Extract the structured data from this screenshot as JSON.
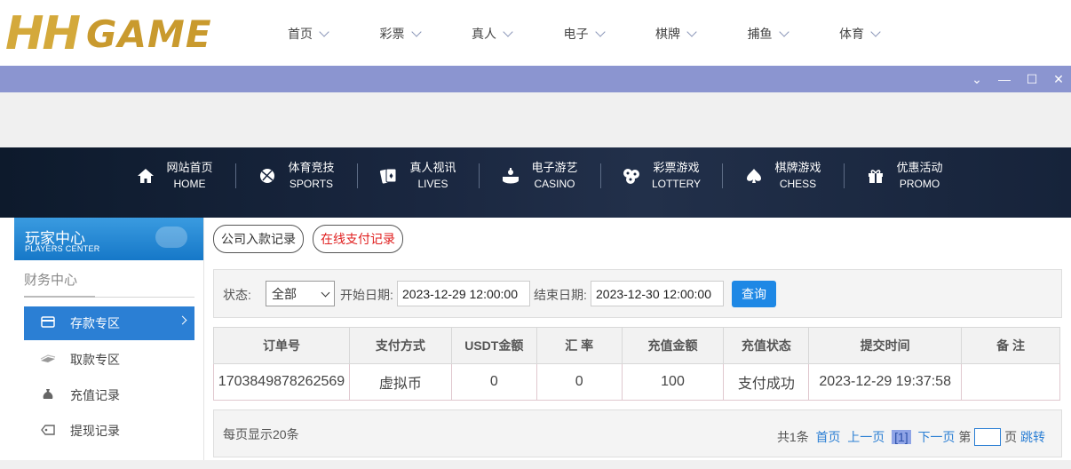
{
  "logo": {
    "mark": "HH",
    "text": "GAME"
  },
  "top_nav": [
    "首页",
    "彩票",
    "真人",
    "电子",
    "棋牌",
    "捕鱼",
    "体育"
  ],
  "window_controls": [
    "⌄",
    "—",
    "☐",
    "✕"
  ],
  "banner_nav": [
    {
      "cn": "网站首页",
      "en": "HOME",
      "icon": "home-icon"
    },
    {
      "cn": "体育竞技",
      "en": "SPORTS",
      "icon": "ball-icon"
    },
    {
      "cn": "真人视讯",
      "en": "LIVES",
      "icon": "cards-icon"
    },
    {
      "cn": "电子游艺",
      "en": "CASINO",
      "icon": "slot-icon"
    },
    {
      "cn": "彩票游戏",
      "en": "LOTTERY",
      "icon": "lottery-balls-icon"
    },
    {
      "cn": "棋牌游戏",
      "en": "CHESS",
      "icon": "spade-icon"
    },
    {
      "cn": "优惠活动",
      "en": "PROMO",
      "icon": "gift-icon"
    }
  ],
  "sidebar": {
    "title": "玩家中心",
    "subtitle": "PLAYERS CENTER",
    "section": "财务中心",
    "items": [
      {
        "label": "存款专区",
        "icon": "card-icon",
        "active": true
      },
      {
        "label": "取款专区",
        "icon": "cash-icon",
        "active": false
      },
      {
        "label": "充值记录",
        "icon": "moneybag-icon",
        "active": false
      },
      {
        "label": "提现记录",
        "icon": "tag-icon",
        "active": false
      }
    ]
  },
  "tabs": {
    "company": "公司入款记录",
    "online": "在线支付记录"
  },
  "filter": {
    "status_label": "状态:",
    "status_value": "全部",
    "start_label": "开始日期:",
    "start_value": "2023-12-29 12:00:00",
    "end_label": "结束日期:",
    "end_value": "2023-12-30 12:00:00",
    "query": "查询"
  },
  "table": {
    "headers": [
      "订单号",
      "支付方式",
      "USDT金额",
      "汇 率",
      "充值金额",
      "充值状态",
      "提交时间",
      "备 注"
    ],
    "rows": [
      [
        "1703849878262569",
        "虚拟币",
        "0",
        "0",
        "100",
        "支付成功",
        "2023-12-29 19:37:58",
        ""
      ]
    ]
  },
  "pager": {
    "per_page": "每页显示20条",
    "total": "共1条",
    "first": "首页",
    "prev": "上一页",
    "current": "[1]",
    "next": "下一页",
    "di": "第",
    "ye": "页",
    "jump": "跳转"
  },
  "colors": {
    "accent": "#2b7fd4",
    "winbar": "#8b95d0",
    "online_tab": "#e02020"
  }
}
